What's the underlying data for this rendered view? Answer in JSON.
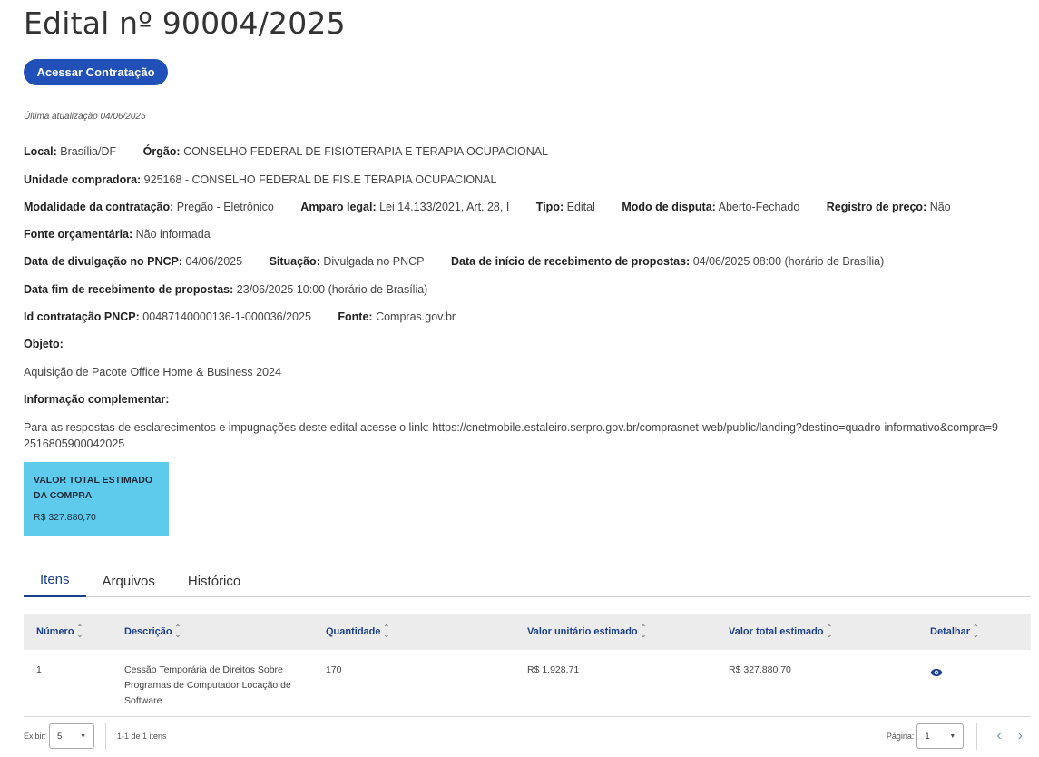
{
  "title": "Edital nº 90004/2025",
  "access_button": "Acessar Contratação",
  "last_update": "Última atualização 04/06/2025",
  "rows": [
    [
      {
        "label": "Local:",
        "value": "Brasília/DF"
      },
      {
        "label": "Órgão:",
        "value": "CONSELHO FEDERAL DE FISIOTERAPIA E TERAPIA OCUPACIONAL"
      }
    ],
    [
      {
        "label": "Unidade compradora:",
        "value": "925168 - CONSELHO FEDERAL DE FIS.E TERAPIA OCUPACIONAL"
      }
    ],
    [
      {
        "label": "Modalidade da contratação:",
        "value": "Pregão - Eletrônico"
      },
      {
        "label": "Amparo legal:",
        "value": "Lei 14.133/2021, Art. 28, I"
      },
      {
        "label": "Tipo:",
        "value": "Edital"
      },
      {
        "label": "Modo de disputa:",
        "value": "Aberto-Fechado"
      },
      {
        "label": "Registro de preço:",
        "value": "Não"
      }
    ],
    [
      {
        "label": "Fonte orçamentária:",
        "value": "Não informada"
      }
    ],
    [
      {
        "label": "Data de divulgação no PNCP:",
        "value": "04/06/2025"
      },
      {
        "label": "Situação:",
        "value": "Divulgada no PNCP"
      },
      {
        "label": "Data de início de recebimento de propostas:",
        "value": "04/06/2025 08:00 (horário de Brasília)"
      }
    ],
    [
      {
        "label": "Data fim de recebimento de propostas:",
        "value": "23/06/2025 10:00 (horário de Brasília)"
      }
    ],
    [
      {
        "label": "Id contratação PNCP:",
        "value": "00487140000136-1-000036/2025"
      },
      {
        "label": "Fonte:",
        "value": "Compras.gov.br"
      }
    ]
  ],
  "objeto_label": "Objeto:",
  "objeto_text": "Aquisição de Pacote Office Home & Business 2024",
  "info_label": "Informação complementar:",
  "info_text": "Para as respostas de esclarecimentos e impugnações deste edital acesse o link: https://cnetmobile.estaleiro.serpro.gov.br/comprasnet-web/public/landing?destino=quadro-informativo&compra=92516805900042025",
  "value_box": {
    "label": "VALOR TOTAL ESTIMADO DA COMPRA",
    "value": "R$ 327.880,70",
    "color": "#5ecbed"
  },
  "tabs": [
    "Itens",
    "Arquivos",
    "Histórico"
  ],
  "active_tab": 0,
  "table": {
    "headers": [
      "Número",
      "Descrição",
      "Quantidade",
      "Valor unitário estimado",
      "Valor total estimado",
      "Detalhar"
    ],
    "rows": [
      {
        "numero": "1",
        "descricao": "Cessão Temporária de Direitos Sobre Programas de Computador Locação de Software",
        "quantidade": "170",
        "valor_unitario": "R$ 1.928,71",
        "valor_total": "R$ 327.880,70",
        "detalhar_icon": "eye-icon"
      }
    ]
  },
  "footer": {
    "exibir_label": "Exibir:",
    "exibir_value": "5",
    "range_text": "1-1 de 1 itens",
    "pagina_label": "Página:",
    "pagina_value": "1"
  },
  "colors": {
    "primary": "#2151b8",
    "link": "#1b3f8b",
    "header_bg": "#ececec"
  }
}
